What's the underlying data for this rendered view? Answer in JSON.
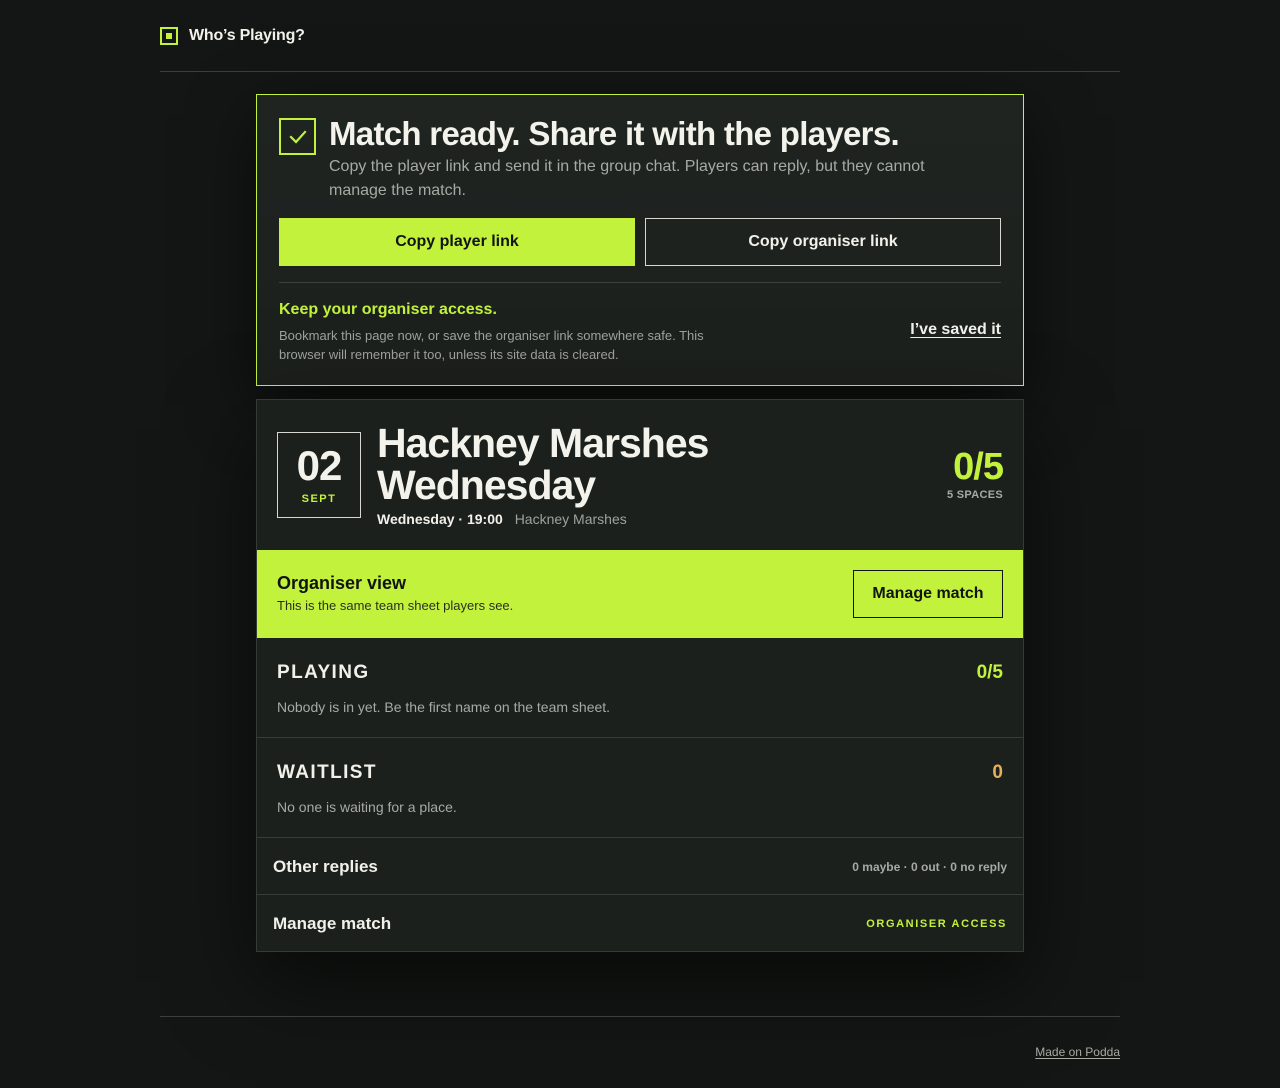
{
  "app": {
    "brand": "Who’s Playing?"
  },
  "share": {
    "title": "Match ready. Share it with the players.",
    "description": "Copy the player link and send it in the group chat. Players can reply, but they cannot manage the match.",
    "copy_player_label": "Copy player link",
    "copy_organiser_label": "Copy organiser link",
    "keep_title": "Keep your organiser access.",
    "keep_desc": "Bookmark this page now, or save the organiser link somewhere safe. This browser will remember it too, unless its site data is cleared.",
    "saved_label": "I’ve saved it"
  },
  "match": {
    "day": "02",
    "month": "SEPT",
    "title": "Hackney Marshes Wednesday",
    "when": "Wednesday · 19:00",
    "place": "Hackney Marshes",
    "spaces_count": "0/5",
    "spaces_label": "5 SPACES"
  },
  "organiser": {
    "title": "Organiser view",
    "desc": "This is the same team sheet players see.",
    "manage_label": "Manage match"
  },
  "playing": {
    "title": "PLAYING",
    "count": "0/5",
    "desc": "Nobody is in yet. Be the first name on the team sheet."
  },
  "waitlist": {
    "title": "WAITLIST",
    "count": "0",
    "desc": "No one is waiting for a place."
  },
  "other_replies": {
    "title": "Other replies",
    "meta": "0 maybe · 0 out · 0 no reply"
  },
  "manage_row": {
    "title": "Manage match",
    "access": "ORGANISER ACCESS"
  },
  "footer": {
    "link": "Made on Podda"
  },
  "colors": {
    "accent": "#c2f23c",
    "waitlist_count": "#e3b05c",
    "background": "#131614",
    "card": "#1c201d"
  },
  "icons": {
    "logo": "square-logo-icon",
    "check": "check-icon"
  }
}
